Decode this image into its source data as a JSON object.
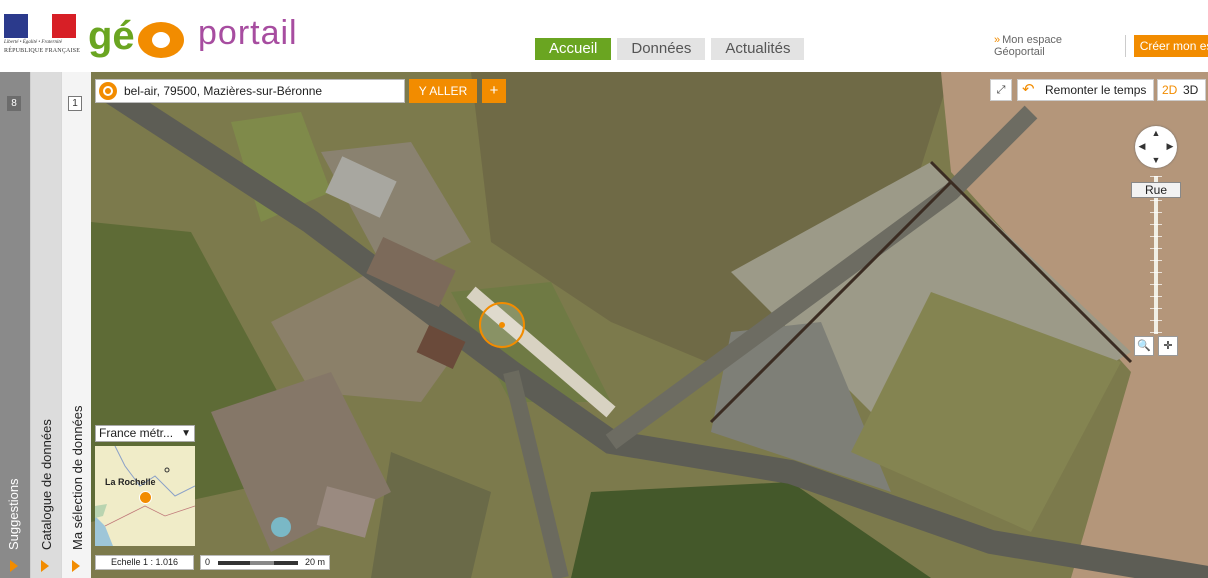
{
  "header": {
    "rf_logo": {
      "motto": "Liberté • Égalité • Fraternité",
      "name": "RÉPUBLIQUE FRANÇAISE"
    },
    "geo_logo": {
      "prefix": "gé",
      "word": "portail"
    },
    "tabs": [
      {
        "label": "Accueil",
        "active": true
      },
      {
        "label": "Données",
        "active": false
      },
      {
        "label": "Actualités",
        "active": false
      }
    ],
    "espace_link": "Mon espace Géoportail",
    "creer_button": "Créer mon espace"
  },
  "side_panels": {
    "suggestions": {
      "label": "Suggestions",
      "count": "8"
    },
    "catalogue": {
      "label": "Catalogue de données"
    },
    "selection": {
      "label": "Ma sélection de données",
      "count": "1"
    }
  },
  "map": {
    "search": {
      "value": "bel-air, 79500, Mazières-sur-Béronne",
      "go_label": "Y ALLER",
      "plus_label": "+"
    },
    "toolbar": {
      "fullscreen_icon": "fullscreen-icon",
      "time_label": "Remonter le temps",
      "dim_2d": "2D",
      "dim_3d": "3D"
    },
    "zoom": {
      "level_label": "Rue"
    },
    "overview": {
      "selected": "France métr...",
      "city_label": "La Rochelle"
    },
    "scale": {
      "ratio": "Echelle 1 :  1.016",
      "zero": "0",
      "distance": "20 m"
    },
    "colors": {
      "accent": "#f28c00",
      "green": "#6aa521",
      "purple": "#a74da0"
    }
  }
}
